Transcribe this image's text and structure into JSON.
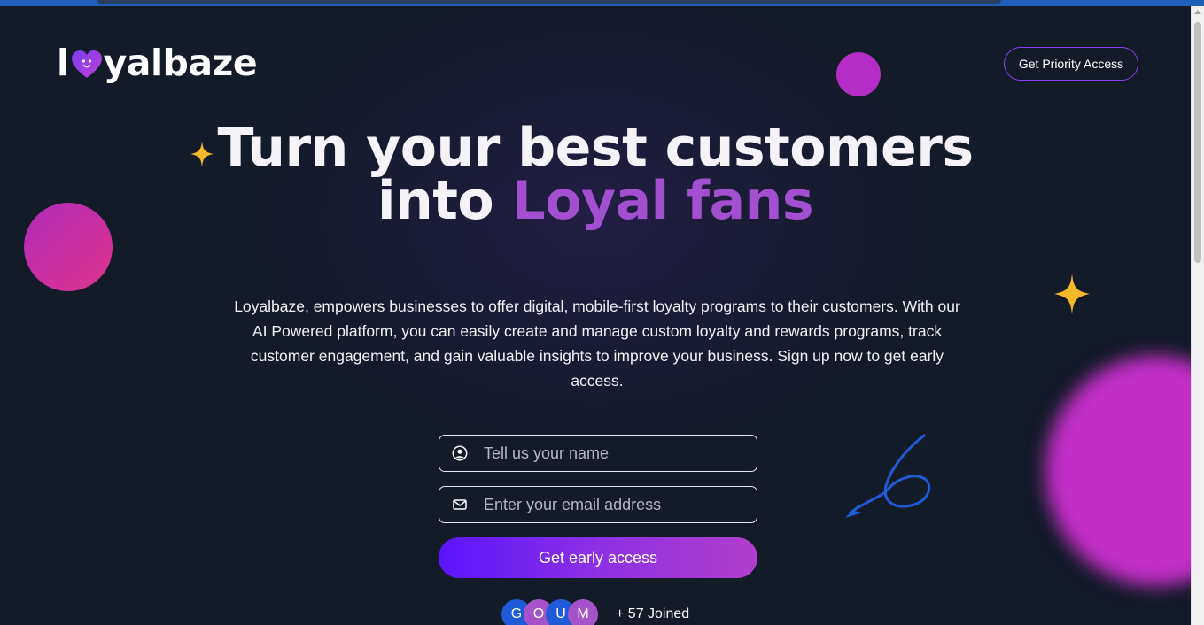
{
  "brand": {
    "logo_left": "l",
    "logo_right": "yalbaze",
    "logo_icon": "heart-icon"
  },
  "header": {
    "cta_label": "Get Priority Access"
  },
  "hero": {
    "title_part1": "Turn your best customers into ",
    "title_accent": "Loyal fans",
    "description": "Loyalbaze, empowers businesses to offer digital, mobile-first loyalty programs to their customers. With our AI Powered platform, you can easily create and manage custom loyalty and rewards programs, track customer engagement, and gain valuable insights to improve your business. Sign up now to get early access."
  },
  "form": {
    "name": {
      "placeholder": "Tell us your name",
      "value": "",
      "icon": "user-icon"
    },
    "email": {
      "placeholder": "Enter your email address",
      "value": "",
      "icon": "mail-icon"
    },
    "submit_label": "Get early access"
  },
  "social_proof": {
    "avatars": [
      "G",
      "O",
      "U",
      "M"
    ],
    "joined_text": "+ 57 Joined"
  },
  "colors": {
    "background": "#131a28",
    "accent_purple": "#a24fd0",
    "button_gradient_start": "#5a14ff",
    "button_gradient_end": "#b13fcc",
    "star_yellow": "#f5b82a",
    "arrow_blue": "#1f5bd8"
  }
}
